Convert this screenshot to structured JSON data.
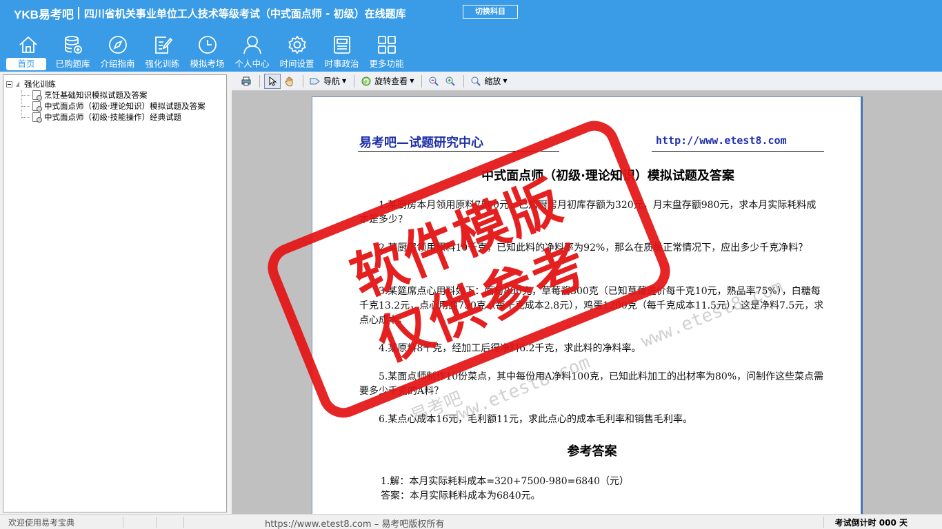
{
  "header": {
    "brand": "YKB易考吧",
    "title": "四川省机关事业单位工人技术等级考试（中式面点师 - 初级）在线题库",
    "switch_label": "切换科目"
  },
  "nav": [
    {
      "label": "首页",
      "icon": "home-icon"
    },
    {
      "label": "已购题库",
      "icon": "database-icon"
    },
    {
      "label": "介绍指南",
      "icon": "compass-icon"
    },
    {
      "label": "强化训练",
      "icon": "edit-icon"
    },
    {
      "label": "模拟考场",
      "icon": "clock-icon"
    },
    {
      "label": "个人中心",
      "icon": "user-icon"
    },
    {
      "label": "时间设置",
      "icon": "gear-icon"
    },
    {
      "label": "时事政治",
      "icon": "news-icon"
    },
    {
      "label": "更多功能",
      "icon": "grid-icon"
    }
  ],
  "tree": {
    "root": "强化训练",
    "items": [
      "烹饪基础知识模拟试题及答案",
      "中式面点师（初级·理论知识）模拟试题及答案",
      "中式面点师（初级·技能操作）经典试题"
    ]
  },
  "toolbar": {
    "nav_label": "导航",
    "rotate_label": "旋转查看",
    "zoom_label": "缩放"
  },
  "document": {
    "header_left": "易考吧—试题研究中心",
    "header_right": "http://www.etest8.com",
    "title": "中式面点师（初级·理论知识）模拟试题及答案",
    "q1": "1.某厨房本月领用原料7500元，已知厨房月初库存额为320元，月末盘存额980元，求本月实际耗料成本是多少？",
    "q2": "2.某厨房领用原料10千克，已知此料的净料率为92%，那么在质量正常情况下，应出多少千克净料？",
    "q3": "3.某筵席点心用料如下：面粉800克，草莓酱300克（已知草莓进价每千克10元，熟品率75%），白糖每千克13.2元，点心用面750克（每千克成本2.8元），鸡蛋1200克（每千克成本11.5元），这是净料7.5元，求点心成本。",
    "q4": "4.某原料8千克，经加工后得净料6.2千克，求此料的净料率。",
    "q5": "5.某面点师制作10份菜点，其中每份用A净料100克，已知此料加工的出材率为80%，问制作这些菜点需要多少千克的A料？",
    "q6": "6.某点心成本16元，毛利额11元，求此点心的成本毛利率和销售毛利率。",
    "answers_title": "参考答案",
    "a1_line1": "1.解：本月实际耗料成本=320+7500-980=6840（元）",
    "a1_line2": "答案：本月实际耗料成本为6840元。",
    "watermark_url": "www.etest8.com",
    "watermark_cn": "易考吧"
  },
  "stamp": {
    "line1": "软件模版",
    "line2": "仅供参考",
    "color": "#e41414"
  },
  "status": {
    "welcome": "欢迎使用易考宝典",
    "copyright": "https://www.etest8.com – 易考吧版权所有",
    "countdown": "考试倒计时 000 天"
  }
}
